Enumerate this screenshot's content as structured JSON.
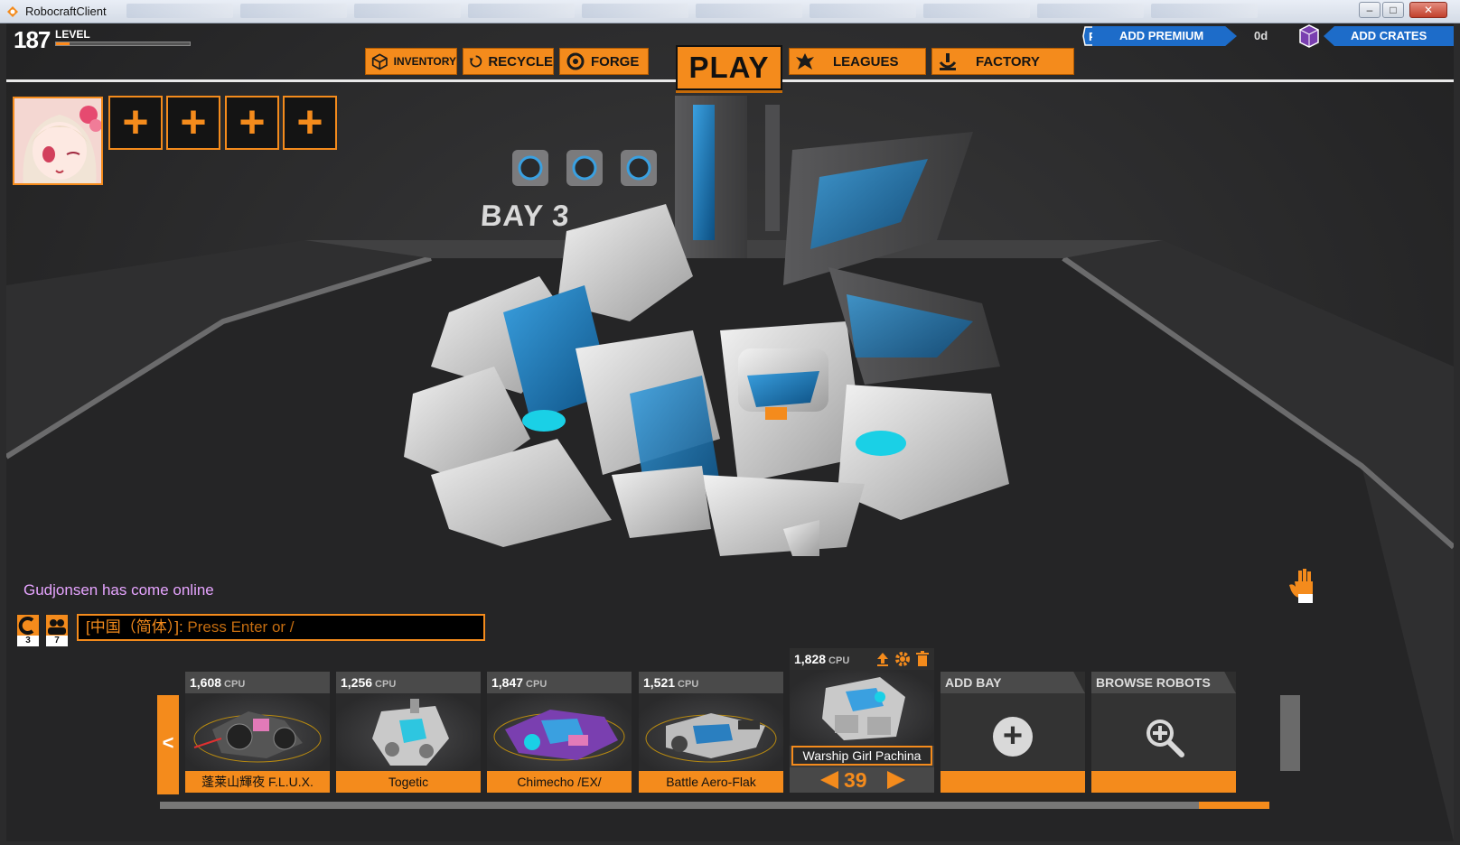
{
  "window": {
    "title": "RobocraftClient"
  },
  "hud": {
    "level_number": "187",
    "level_label": "LEVEL",
    "level_progress": 0.1,
    "premium_label": "ADD PREMIUM",
    "premium_days": "0d",
    "crates_label": "ADD CRATES"
  },
  "nav": {
    "inventory": "INVENTORY",
    "recycle": "RECYCLE",
    "forge": "FORGE",
    "play": "PLAY",
    "leagues": "LEAGUES",
    "factory": "FACTORY"
  },
  "party": {
    "slot_symbol": "+"
  },
  "scene": {
    "bay_label": "BAY 3"
  },
  "chat": {
    "message": "Gudjonsen has come online",
    "channel": "[中国（简体）]:",
    "placeholder": "Press Enter or /",
    "count_a": "3",
    "count_b": "7"
  },
  "bays": {
    "cpu_unit": "CPU",
    "prev_arrow": "<",
    "items": [
      {
        "cpu": "1,608",
        "name": "蓬莱山輝夜 F.L.U.X."
      },
      {
        "cpu": "1,256",
        "name": "Togetic"
      },
      {
        "cpu": "1,847",
        "name": "Chimecho /EX/"
      },
      {
        "cpu": "1,521",
        "name": "Battle Aero-Flak"
      }
    ],
    "selected": {
      "cpu": "1,828",
      "name": "Warship Girl Pachina",
      "page": "39"
    },
    "add_bay": "ADD BAY",
    "browse_robots": "BROWSE ROBOTS"
  },
  "colors": {
    "accent": "#f48b1c",
    "premium": "#1d6cc9",
    "chat_message": "#e6a4ff"
  }
}
